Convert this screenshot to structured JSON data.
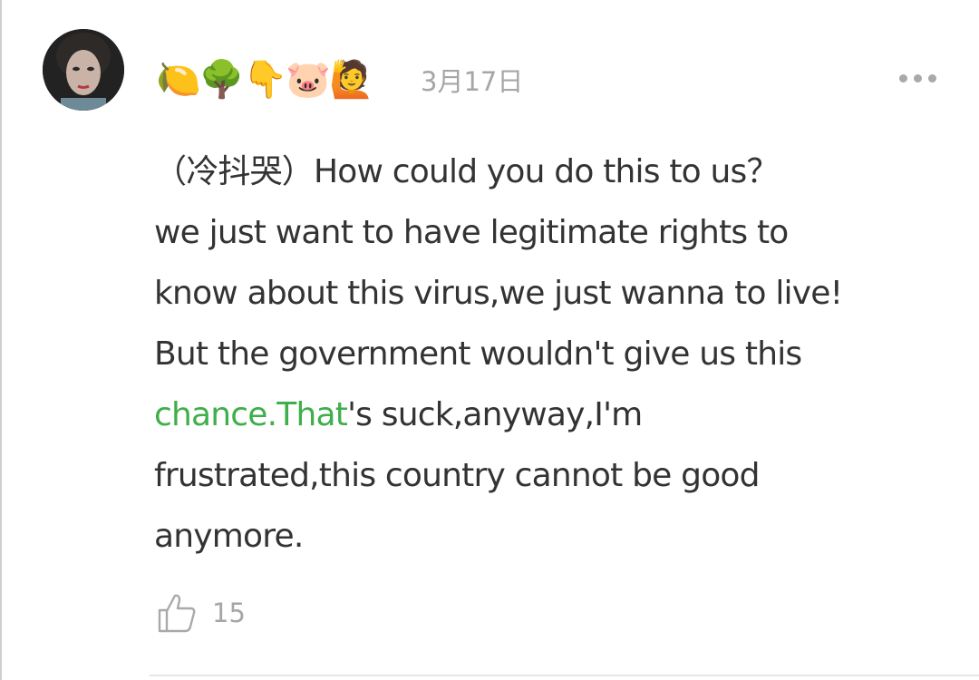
{
  "comment": {
    "username_emojis": "🍋🌳👇🐷🙋",
    "timestamp": "3月17日",
    "more_icon": "more-dots-icon",
    "text_lines": [
      "（冷抖哭）How could you do this to us？",
      "we just want to have legitimate rights to",
      "know about this virus,we just wanna to live!",
      "But the government wouldn't give us this"
    ],
    "link_text": "chance.That",
    "after_link_text": "'s suck,anyway,I'm",
    "text_lines_end": [
      "frustrated,this country cannot be good",
      "anymore."
    ],
    "like_icon": "thumbs-up-icon",
    "like_count": "15"
  },
  "colors": {
    "link": "#3fae4b",
    "text": "#333333",
    "meta": "#a6a6a6"
  }
}
